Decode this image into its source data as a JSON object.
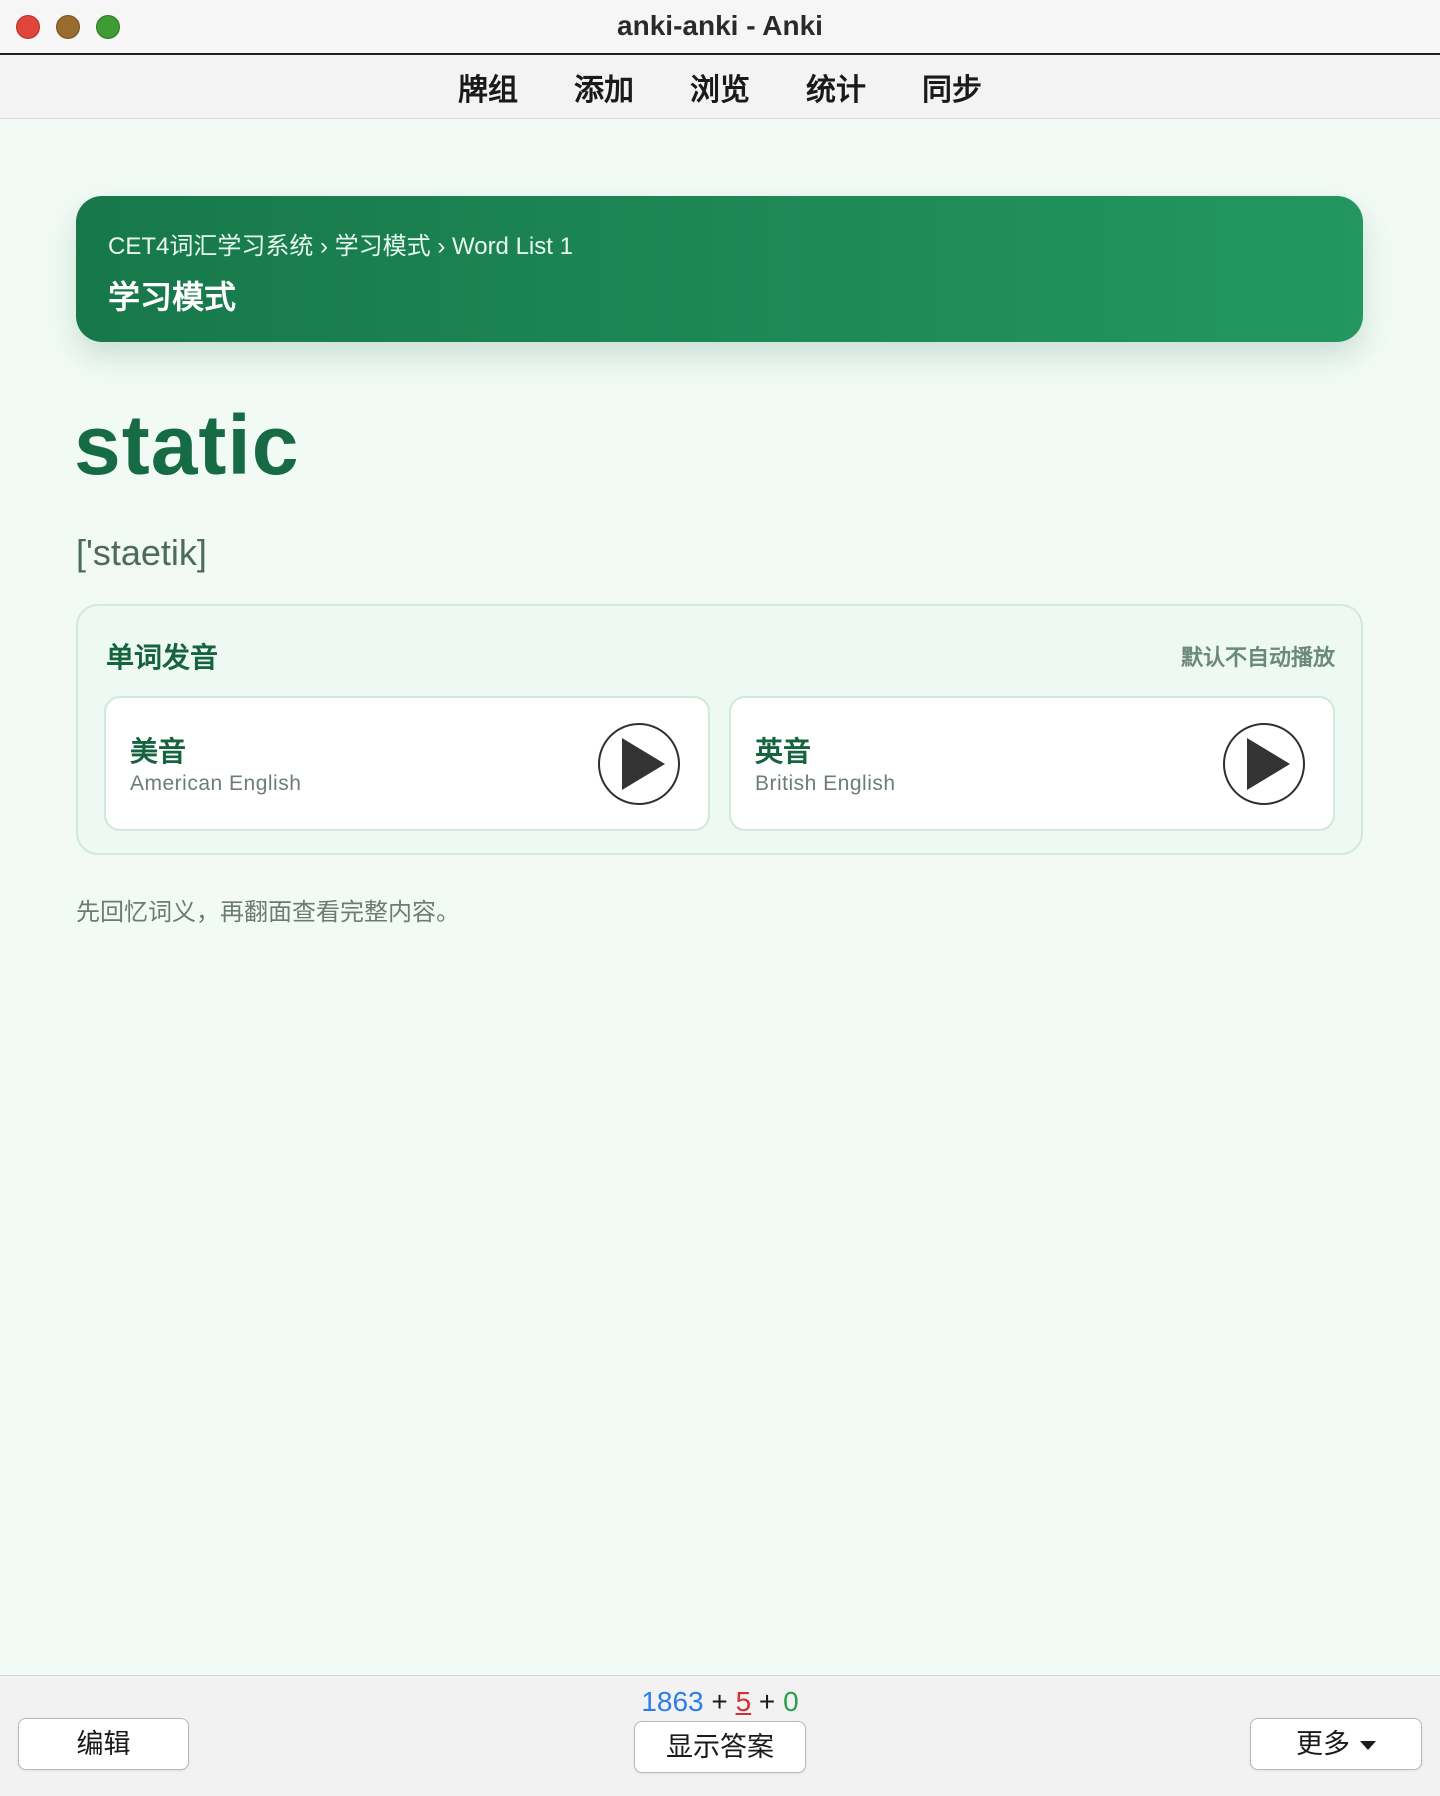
{
  "window": {
    "title": "anki-anki - Anki"
  },
  "toolbar": {
    "items": [
      "牌组",
      "添加",
      "浏览",
      "统计",
      "同步"
    ]
  },
  "header": {
    "breadcrumb": "CET4词汇学习系统 › 学习模式 › Word List 1",
    "title": "学习模式"
  },
  "card": {
    "word": "static",
    "phonetic": "['staetik]",
    "audio": {
      "title": "单词发音",
      "note": "默认不自动播放",
      "voices": [
        {
          "name": "美音",
          "sub": "American English",
          "icon": "play-icon"
        },
        {
          "name": "英音",
          "sub": "British English",
          "icon": "play-icon"
        }
      ]
    },
    "hint": "先回忆词义，再翻面查看完整内容。"
  },
  "bottom": {
    "counts": {
      "new": "1863",
      "learn": "5",
      "review": "0",
      "sep": " + "
    },
    "edit_label": "编辑",
    "show_answer_label": "显示答案",
    "more_label": "更多"
  },
  "colors": {
    "accent": "#1f8f59",
    "accent_dark": "#166b45",
    "new_count": "#2b7de9",
    "learn_count": "#d32f2f",
    "review_count": "#2e9d4a"
  }
}
